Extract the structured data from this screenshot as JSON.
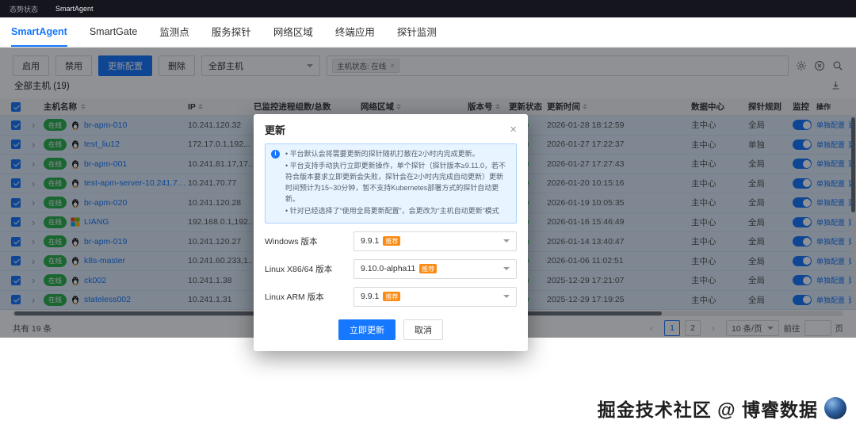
{
  "colors": {
    "accent": "#1677ff",
    "online_green": "#28b14b",
    "status_dot_green": "#2fc043",
    "recommend_orange": "#fa8c16"
  },
  "topbar": {
    "breadcrumb_1": "态势状态",
    "breadcrumb_2": "SmartAgent"
  },
  "tabs": {
    "items": [
      {
        "label": "SmartAgent",
        "active": true
      },
      {
        "label": "SmartGate",
        "active": false
      },
      {
        "label": "监测点",
        "active": false
      },
      {
        "label": "服务探针",
        "active": false
      },
      {
        "label": "网络区域",
        "active": false
      },
      {
        "label": "终端应用",
        "active": false
      },
      {
        "label": "探针监测",
        "active": false
      }
    ]
  },
  "toolbar": {
    "enable": "启用",
    "disable": "禁用",
    "update_config": "更新配置",
    "delete": "删除",
    "scope_select_value": "全部主机",
    "filter_tag": "主机状态: 在线",
    "icons": [
      "gear-icon",
      "clear-circle-icon",
      "search-icon"
    ]
  },
  "summary": {
    "all_hosts": "全部主机 (19)"
  },
  "table": {
    "headers": [
      "主机名称",
      "IP",
      "已监控进程组数/总数",
      "网络区域",
      "版本号",
      "更新状态",
      "更新时间",
      "数据中心",
      "探针规则",
      "监控",
      "操作"
    ],
    "ops_config": "单独配置",
    "ops_more": "更多",
    "rows": [
      {
        "status": "在线",
        "os": "linux",
        "name": "br-apm-010",
        "ip": "10.241.120.32",
        "time": "2026-01-28 18:12:59",
        "dc": "主中心",
        "rule": "全局"
      },
      {
        "status": "在线",
        "os": "linux",
        "name": "test_liu12",
        "ip": "172.17.0.1,192...",
        "time": "2026-01-27 17:22:37",
        "dc": "主中心",
        "rule": "单独"
      },
      {
        "status": "在线",
        "os": "linux",
        "name": "br-apm-001",
        "ip": "10.241.81.17,17...",
        "time": "2026-01-27 17:27:43",
        "dc": "主中心",
        "rule": "全局"
      },
      {
        "status": "在线",
        "os": "linux",
        "name": "test-apm-server-10.241.70...",
        "ip": "10.241.70.77",
        "time": "2026-01-20 10:15:16",
        "dc": "主中心",
        "rule": "全局"
      },
      {
        "status": "在线",
        "os": "linux",
        "name": "br-apm-020",
        "ip": "10.241.120.28",
        "time": "2026-01-19 10:05:35",
        "dc": "主中心",
        "rule": "全局"
      },
      {
        "status": "在线",
        "os": "windows",
        "name": "LIANG",
        "ip": "192.168.0.1,192...",
        "time": "2026-01-16 15:46:49",
        "dc": "主中心",
        "rule": "全局"
      },
      {
        "status": "在线",
        "os": "linux",
        "name": "br-apm-019",
        "ip": "10.241.120.27",
        "time": "2026-01-14 13:40:47",
        "dc": "主中心",
        "rule": "全局"
      },
      {
        "status": "在线",
        "os": "linux",
        "name": "k8s-master",
        "ip": "10.241.60.233,1...",
        "time": "2026-01-06 11:02:51",
        "dc": "主中心",
        "rule": "全局"
      },
      {
        "status": "在线",
        "os": "linux",
        "name": "ck002",
        "ip": "10.241.1.38",
        "time": "2025-12-29 17:21:07",
        "dc": "主中心",
        "rule": "全局"
      },
      {
        "status": "在线",
        "os": "linux",
        "name": "stateless002",
        "ip": "10.241.1.31",
        "time": "2025-12-29 17:19:25",
        "dc": "主中心",
        "rule": "全局"
      }
    ]
  },
  "footer": {
    "total": "共有 19 条",
    "prev": "‹",
    "page1": "1",
    "page2": "2",
    "next": "›",
    "page_size": "10 条/页",
    "goto_label": "前往",
    "page_unit": "页"
  },
  "modal": {
    "title": "更新",
    "notes": [
      "平台默认会将需要更新的探针随机打散在2小时内完成更新。",
      "平台支持手动执行立即更新操作，单个探针（探针版本≥9.11.0，若不符合版本要求立即更新会失败，探针会在2小时内完成自动更新）更新时间预计为15~30分钟，暂不支持Kubernetes部署方式的探针自动更新。",
      "针对已经选择了“使用全局更新配置”，会更改为“主机自动更新”模式"
    ],
    "fields": [
      {
        "label": "Windows 版本",
        "value": "9.9.1",
        "badge": "推荐"
      },
      {
        "label": "Linux X86/64 版本",
        "value": "9.10.0-alpha11",
        "badge": "推荐"
      },
      {
        "label": "Linux ARM 版本",
        "value": "9.9.1",
        "badge": "推荐"
      }
    ],
    "ok_label": "立即更新",
    "cancel_label": "取消"
  },
  "watermark": {
    "text": "掘金技术社区 @ 博睿数据"
  }
}
